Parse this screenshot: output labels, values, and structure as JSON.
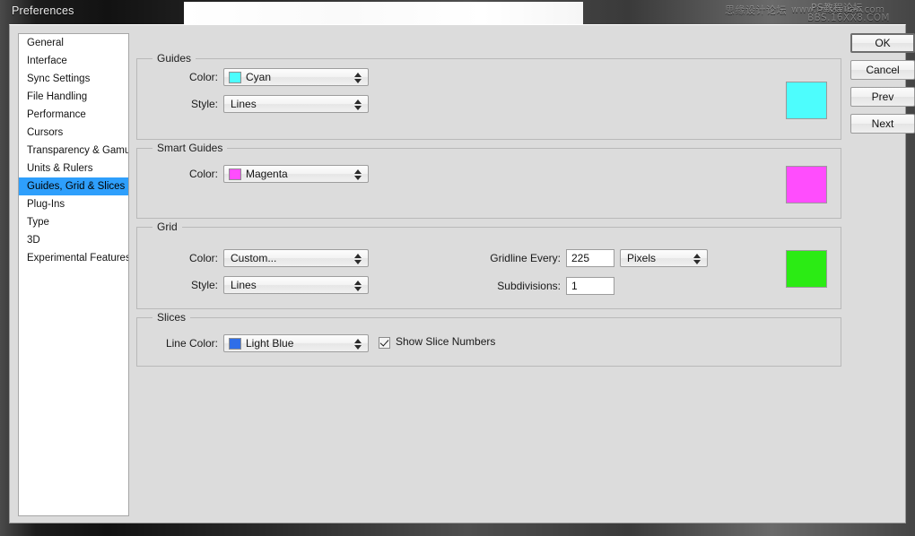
{
  "window": {
    "title": "Preferences",
    "watermark": {
      "cn_forum": "思缘设计论坛",
      "url": "www.missyuan.com",
      "cn_tutorial": "PS教程论坛",
      "bbs": "BBS.16XX8.COM"
    }
  },
  "sidebar": {
    "items": [
      {
        "label": "General",
        "selected": false
      },
      {
        "label": "Interface",
        "selected": false
      },
      {
        "label": "Sync Settings",
        "selected": false
      },
      {
        "label": "File Handling",
        "selected": false
      },
      {
        "label": "Performance",
        "selected": false
      },
      {
        "label": "Cursors",
        "selected": false
      },
      {
        "label": "Transparency & Gamut",
        "selected": false
      },
      {
        "label": "Units & Rulers",
        "selected": false
      },
      {
        "label": "Guides, Grid & Slices",
        "selected": true
      },
      {
        "label": "Plug-Ins",
        "selected": false
      },
      {
        "label": "Type",
        "selected": false
      },
      {
        "label": "3D",
        "selected": false
      },
      {
        "label": "Experimental Features",
        "selected": false
      }
    ]
  },
  "groups": {
    "guides": {
      "title": "Guides",
      "color_label": "Color:",
      "color_value": "Cyan",
      "color_hex": "#4dfdfd",
      "style_label": "Style:",
      "style_value": "Lines",
      "preview_hex": "#4dfdfd"
    },
    "smart_guides": {
      "title": "Smart Guides",
      "color_label": "Color:",
      "color_value": "Magenta",
      "color_hex": "#ff4dfd",
      "preview_hex": "#ff4dfd"
    },
    "grid": {
      "title": "Grid",
      "color_label": "Color:",
      "color_value": "Custom...",
      "style_label": "Style:",
      "style_value": "Lines",
      "gridline_label": "Gridline Every:",
      "gridline_value": "225",
      "gridline_unit": "Pixels",
      "subdivisions_label": "Subdivisions:",
      "subdivisions_value": "1",
      "preview_hex": "#2beb14"
    },
    "slices": {
      "title": "Slices",
      "line_color_label": "Line Color:",
      "line_color_value": "Light Blue",
      "line_color_hex": "#2f6ee8",
      "show_numbers_label": "Show Slice Numbers",
      "show_numbers_checked": true
    }
  },
  "buttons": {
    "ok": "OK",
    "cancel": "Cancel",
    "prev": "Prev",
    "next": "Next"
  },
  "theme": {
    "dialog_bg": "#dcdcdc",
    "selection_blue": "#2e9ffc"
  }
}
